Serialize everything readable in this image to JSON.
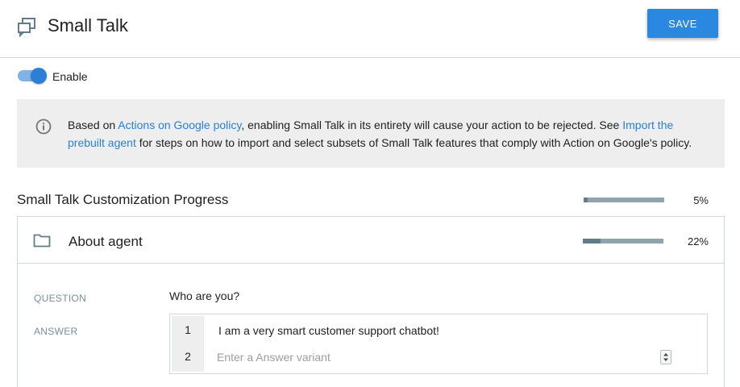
{
  "header": {
    "title": "Small Talk",
    "save_label": "SAVE",
    "icon": "chat-bubbles-icon"
  },
  "toggle": {
    "label": "Enable",
    "enabled": true
  },
  "info": {
    "icon": "info-icon",
    "text_before": "Based on ",
    "link1": "Actions on Google policy",
    "text_middle": ", enabling Small Talk in its entirety will cause your action to be rejected. See ",
    "link2": "Import the prebuilt agent",
    "text_after": " for steps on how to import and select subsets of Small Talk features that comply with Action on Google's policy."
  },
  "progress": {
    "title": "Small Talk Customization Progress",
    "percent_label": "5%",
    "percent": 5
  },
  "panel": {
    "title": "About agent",
    "icon": "folder-icon",
    "percent_label": "22%",
    "percent": 22,
    "question_label": "QUESTION",
    "question": "Who are you?",
    "answer_label": "ANSWER",
    "answers": [
      {
        "num": "1",
        "text": "I am a very smart customer support chatbot!"
      },
      {
        "num": "2",
        "placeholder": "Enter a Answer variant"
      }
    ]
  },
  "colors": {
    "accent": "#2b88e0",
    "link": "#2b7fd6",
    "banner_bg": "#eeeeee",
    "bar": "#90a4ae"
  }
}
